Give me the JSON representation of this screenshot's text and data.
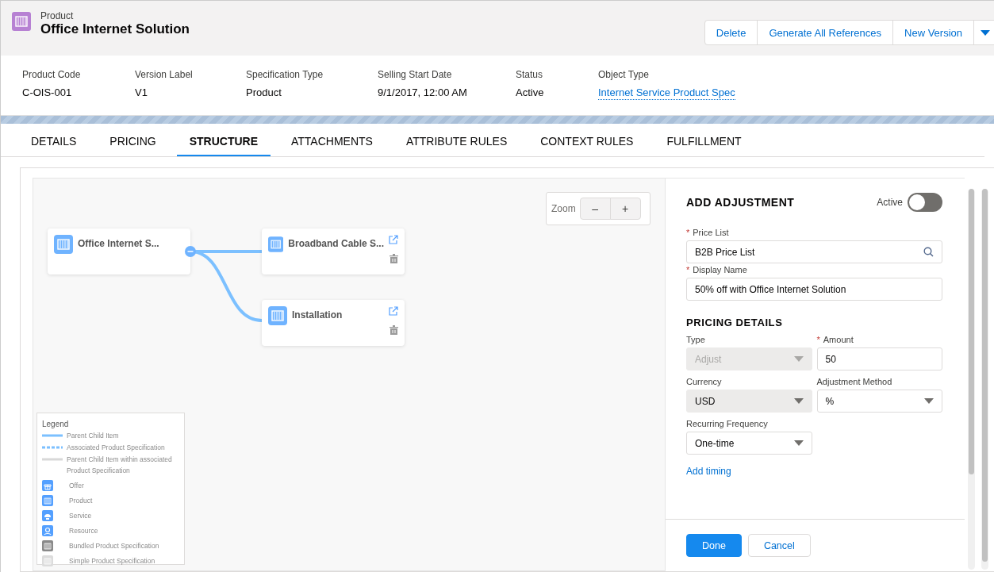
{
  "header": {
    "object_label": "Product",
    "title": "Office Internet Solution",
    "buttons": [
      "Delete",
      "Generate All References",
      "New Version"
    ]
  },
  "fields": [
    {
      "label": "Product Code",
      "value": "C-OIS-001",
      "kind": "text"
    },
    {
      "label": "Version Label",
      "value": "V1",
      "kind": "text"
    },
    {
      "label": "Specification Type",
      "value": "Product",
      "kind": "text"
    },
    {
      "label": "Selling Start Date",
      "value": "9/1/2017, 12:00 AM",
      "kind": "text"
    },
    {
      "label": "Status",
      "value": "Active",
      "kind": "text"
    },
    {
      "label": "Object Type",
      "value": "Internet Service Product Spec",
      "kind": "link"
    }
  ],
  "tabs": [
    {
      "label": "DETAILS",
      "selected": false
    },
    {
      "label": "PRICING",
      "selected": false
    },
    {
      "label": "STRUCTURE",
      "selected": true
    },
    {
      "label": "ATTACHMENTS",
      "selected": false
    },
    {
      "label": "ATTRIBUTE RULES",
      "selected": false
    },
    {
      "label": "CONTEXT RULES",
      "selected": false
    },
    {
      "label": "FULFILLMENT",
      "selected": false
    }
  ],
  "canvas": {
    "zoom": {
      "label": "Zoom",
      "buttons": [
        "–",
        "+"
      ]
    },
    "nodes": [
      {
        "label": "Office Internet S...",
        "kind": "root"
      },
      {
        "label": "Broadband Cable S...",
        "kind": "child"
      },
      {
        "label": "Installation",
        "kind": "child"
      }
    ],
    "legend": {
      "title": "Legend",
      "lines": [
        {
          "label": "Parent Child Item",
          "kind": "solid"
        },
        {
          "label": "Associated Product Specification",
          "kind": "dashed"
        },
        {
          "label": "Parent Child Item within associated Product Specification",
          "kind": "gray"
        }
      ],
      "icons": [
        {
          "label": "Offer",
          "kind": "offer"
        },
        {
          "label": "Product",
          "kind": "product"
        },
        {
          "label": "Service",
          "kind": "service"
        },
        {
          "label": "Resource",
          "kind": "resource"
        },
        {
          "label": "Bundled Product Specification",
          "kind": "bundled"
        },
        {
          "label": "Simple Product Specification",
          "kind": "simple"
        }
      ]
    }
  },
  "panel": {
    "title": "ADD ADJUSTMENT",
    "required_mark": "*",
    "toggle": {
      "label": "Active",
      "on": false
    },
    "rows": [
      [
        {
          "label": "Price List",
          "value": "B2B Price List",
          "kind": "lookup",
          "required": true,
          "disabled": false,
          "readonly": false
        }
      ],
      [
        {
          "label": "Display Name",
          "value": "50% off with Office Internet Solution",
          "kind": "text",
          "required": true,
          "disabled": false,
          "readonly": false
        }
      ],
      {
        "heading": "PRICING DETAILS"
      },
      [
        {
          "label": "Type",
          "value": "Adjust",
          "kind": "select",
          "required": false,
          "disabled": true,
          "readonly": false
        },
        {
          "label": "Amount",
          "value": "50",
          "kind": "text",
          "required": true,
          "disabled": false,
          "readonly": false
        }
      ],
      [
        {
          "label": "Currency",
          "value": "USD",
          "kind": "select",
          "required": false,
          "disabled": false,
          "readonly": true
        },
        {
          "label": "Adjustment Method",
          "value": "%",
          "kind": "select",
          "required": false,
          "disabled": false,
          "readonly": false
        }
      ],
      [
        {
          "label": "Recurring Frequency",
          "value": "One-time",
          "kind": "select",
          "required": false,
          "disabled": false,
          "readonly": false
        },
        {
          "kind": "empty"
        }
      ]
    ],
    "link": "Add timing",
    "buttons": [
      {
        "label": "Done",
        "kind": "primary"
      },
      {
        "label": "Cancel",
        "kind": "neutral"
      }
    ]
  }
}
